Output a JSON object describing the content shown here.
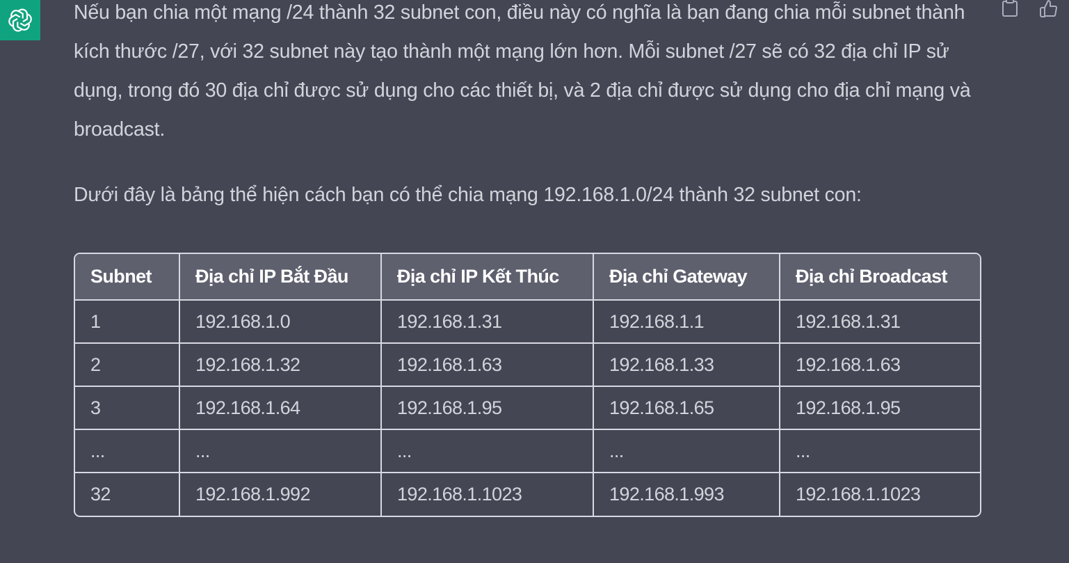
{
  "avatar": {
    "icon": "openai-logo-icon",
    "color": "#10a37f"
  },
  "actions": [
    {
      "icon": "clipboard-icon"
    },
    {
      "icon": "thumbs-up-icon"
    }
  ],
  "message": {
    "paragraphs": [
      "Nếu bạn chia một mạng /24 thành 32 subnet con, điều này có nghĩa là bạn đang chia mỗi subnet thành kích thước /27, với 32 subnet này tạo thành một mạng lớn hơn. Mỗi subnet /27 sẽ có 32 địa chỉ IP sử dụng, trong đó 30 địa chỉ được sử dụng cho các thiết bị, và 2 địa chỉ được sử dụng cho địa chỉ mạng và broadcast.",
      "Dưới đây là bảng thể hiện cách bạn có thể chia mạng 192.168.1.0/24 thành 32 subnet con:"
    ],
    "table": {
      "headers": [
        "Subnet",
        "Địa chỉ IP Bắt Đầu",
        "Địa chỉ IP Kết Thúc",
        "Địa chỉ Gateway",
        "Địa chỉ Broadcast"
      ],
      "rows": [
        [
          "1",
          "192.168.1.0",
          "192.168.1.31",
          "192.168.1.1",
          "192.168.1.31"
        ],
        [
          "2",
          "192.168.1.32",
          "192.168.1.63",
          "192.168.1.33",
          "192.168.1.63"
        ],
        [
          "3",
          "192.168.1.64",
          "192.168.1.95",
          "192.168.1.65",
          "192.168.1.95"
        ],
        [
          "...",
          "...",
          "...",
          "...",
          "..."
        ],
        [
          "32",
          "192.168.1.992",
          "192.168.1.1023",
          "192.168.1.993",
          "192.168.1.1023"
        ]
      ]
    }
  },
  "colors": {
    "background": "#444654",
    "text": "#d1d5db",
    "table_header_bg": "#5e606e",
    "border": "#d9d9e3",
    "accent": "#10a37f"
  }
}
